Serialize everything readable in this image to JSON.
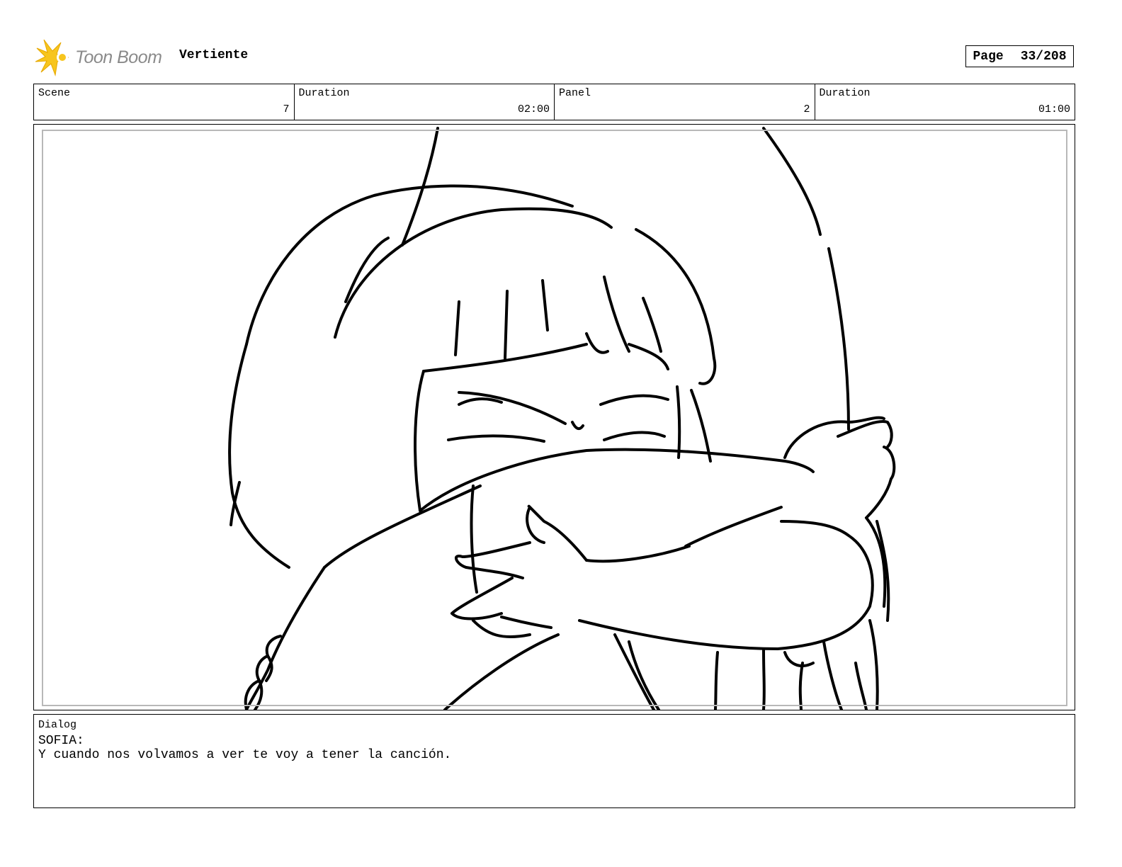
{
  "header": {
    "logo_text": "Toon Boom",
    "project_title": "Vertiente",
    "page_label": "Page",
    "page_number": "33/208"
  },
  "info": {
    "scene_label": "Scene",
    "scene_value": "7",
    "duration_label": "Duration",
    "duration_value": "02:00",
    "panel_label": "Panel",
    "panel_value": "2",
    "panel_duration_label": "Duration",
    "panel_duration_value": "01:00"
  },
  "dialog": {
    "label": "Dialog",
    "speaker": "SOFIA:",
    "line": "Y cuando nos volvamos a ver te voy a tener la canción."
  },
  "colors": {
    "logo_star": "#f7c51e",
    "logo_text": "#8a8a8a",
    "panel_inner_border": "#b8b8b8"
  }
}
